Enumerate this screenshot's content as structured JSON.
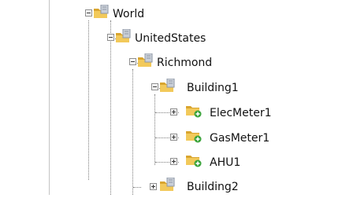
{
  "tree": {
    "nodes": [
      {
        "label": "World",
        "expanded": true,
        "icon": "folder-server-icon"
      },
      {
        "label": "UnitedStates",
        "expanded": true,
        "icon": "folder-server-icon"
      },
      {
        "label": "Richmond",
        "expanded": true,
        "icon": "folder-server-icon"
      },
      {
        "label": "Building1",
        "expanded": true,
        "icon": "folder-server-icon"
      },
      {
        "label": "ElecMeter1",
        "expanded": false,
        "icon": "folder-add-icon"
      },
      {
        "label": "GasMeter1",
        "expanded": false,
        "icon": "folder-add-icon"
      },
      {
        "label": "AHU1",
        "expanded": false,
        "icon": "folder-add-icon"
      },
      {
        "label": "Building2",
        "expanded": false,
        "icon": "folder-server-icon"
      }
    ]
  },
  "colors": {
    "folder": "#f2c95a",
    "folder_dark": "#d9a52f",
    "server": "#c9cfd8",
    "add_badge": "#3aa33a",
    "line": "#7c7c7c"
  }
}
